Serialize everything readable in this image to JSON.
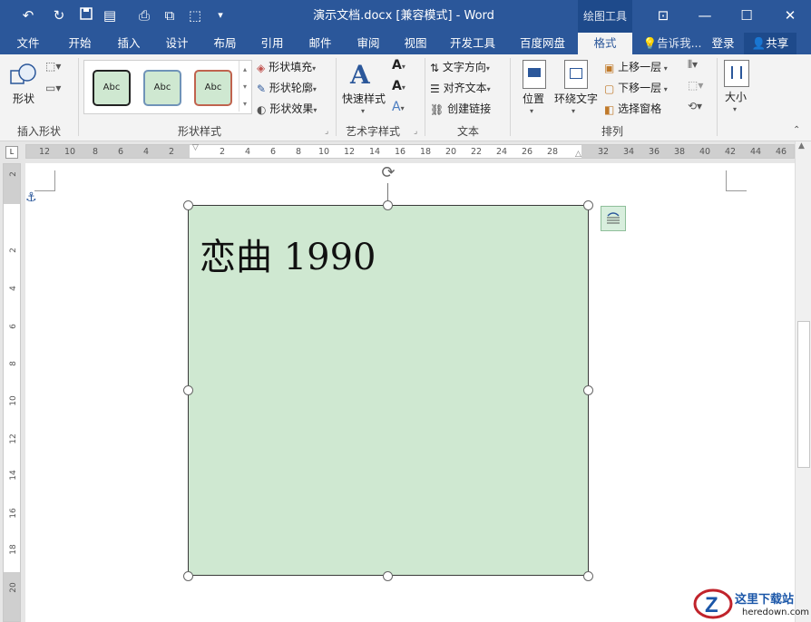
{
  "window": {
    "title": "演示文档.docx [兼容模式] - Word",
    "context_tab": "绘图工具"
  },
  "qat": {
    "undo_icon": "undo-icon",
    "redo_icon": "redo-icon",
    "save_icon": "save-icon",
    "more": "▾"
  },
  "tabs": [
    {
      "label": "文件"
    },
    {
      "label": "开始"
    },
    {
      "label": "插入"
    },
    {
      "label": "设计"
    },
    {
      "label": "布局"
    },
    {
      "label": "引用"
    },
    {
      "label": "邮件"
    },
    {
      "label": "审阅"
    },
    {
      "label": "视图"
    },
    {
      "label": "开发工具"
    },
    {
      "label": "百度网盘"
    },
    {
      "label": "格式"
    }
  ],
  "tell_me": "告诉我...",
  "login": "登录",
  "share": "共享",
  "ribbon": {
    "insert_shapes": {
      "label": "插入形状",
      "shapes_btn": "形状"
    },
    "shape_styles": {
      "label": "形状样式",
      "presets": [
        "Abc",
        "Abc",
        "Abc"
      ],
      "fill": "形状填充",
      "outline": "形状轮廓",
      "effects": "形状效果"
    },
    "wordart": {
      "label": "艺术字样式",
      "quick_styles": "快速样式"
    },
    "text": {
      "label": "文本",
      "direction": "文字方向",
      "align": "对齐文本",
      "link": "创建链接"
    },
    "arrange": {
      "label": "排列",
      "position": "位置",
      "wrap": "环绕文字",
      "bring_forward": "上移一层",
      "send_backward": "下移一层",
      "selection_pane": "选择窗格"
    },
    "size": {
      "label": "大小"
    }
  },
  "ruler": {
    "h_ticks": [
      "12",
      "10",
      "8",
      "6",
      "4",
      "2",
      "2",
      "4",
      "6",
      "8",
      "10",
      "12",
      "14",
      "16",
      "18",
      "20",
      "22",
      "24",
      "26",
      "28",
      "32",
      "34",
      "36",
      "38",
      "40",
      "42",
      "44",
      "46"
    ],
    "v_ticks": [
      "2",
      "2",
      "4",
      "6",
      "8",
      "10",
      "12",
      "14",
      "16",
      "18",
      "20"
    ]
  },
  "shape": {
    "text": "恋曲 1990"
  },
  "watermark": {
    "site": "这里下载站",
    "url": "heredown.com"
  },
  "colors": {
    "accent": "#2b579a",
    "shape_fill": "#cfe8d1"
  }
}
